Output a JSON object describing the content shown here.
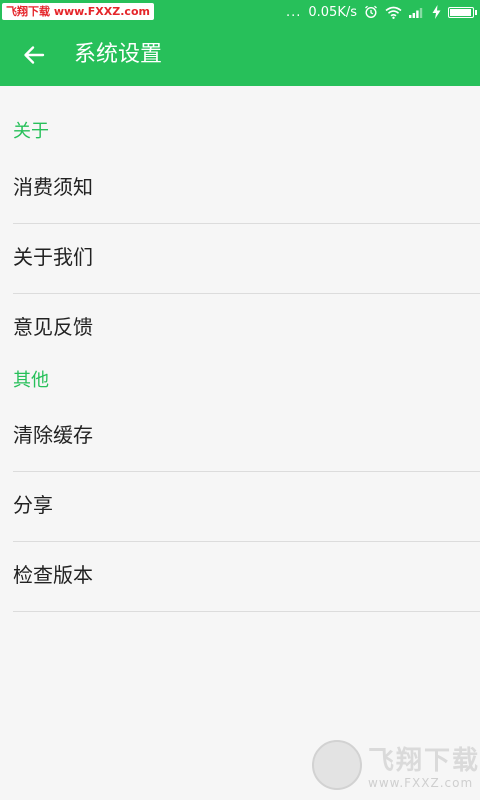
{
  "status_bar": {
    "watermark": "飞翔下载 www.FXXZ.com",
    "dots": "...",
    "network_speed": "0.05K/s",
    "icons": [
      "alarm-icon",
      "wifi-icon",
      "signal-icon",
      "charging-icon",
      "battery-icon"
    ],
    "battery_level": 0.95,
    "background_color": "#27c05a"
  },
  "toolbar": {
    "title": "系统设置",
    "back_icon": "arrow-left-icon",
    "background_color": "#27c05a"
  },
  "sections": [
    {
      "header": "关于",
      "items": [
        "消费须知",
        "关于我们",
        "意见反馈"
      ]
    },
    {
      "header": "其他",
      "items": [
        "清除缓存",
        "分享",
        "检查版本"
      ]
    }
  ],
  "accent_color": "#27c05a",
  "watermark_logo": {
    "title": "飞翔下载",
    "url": "www.FXXZ.com"
  }
}
